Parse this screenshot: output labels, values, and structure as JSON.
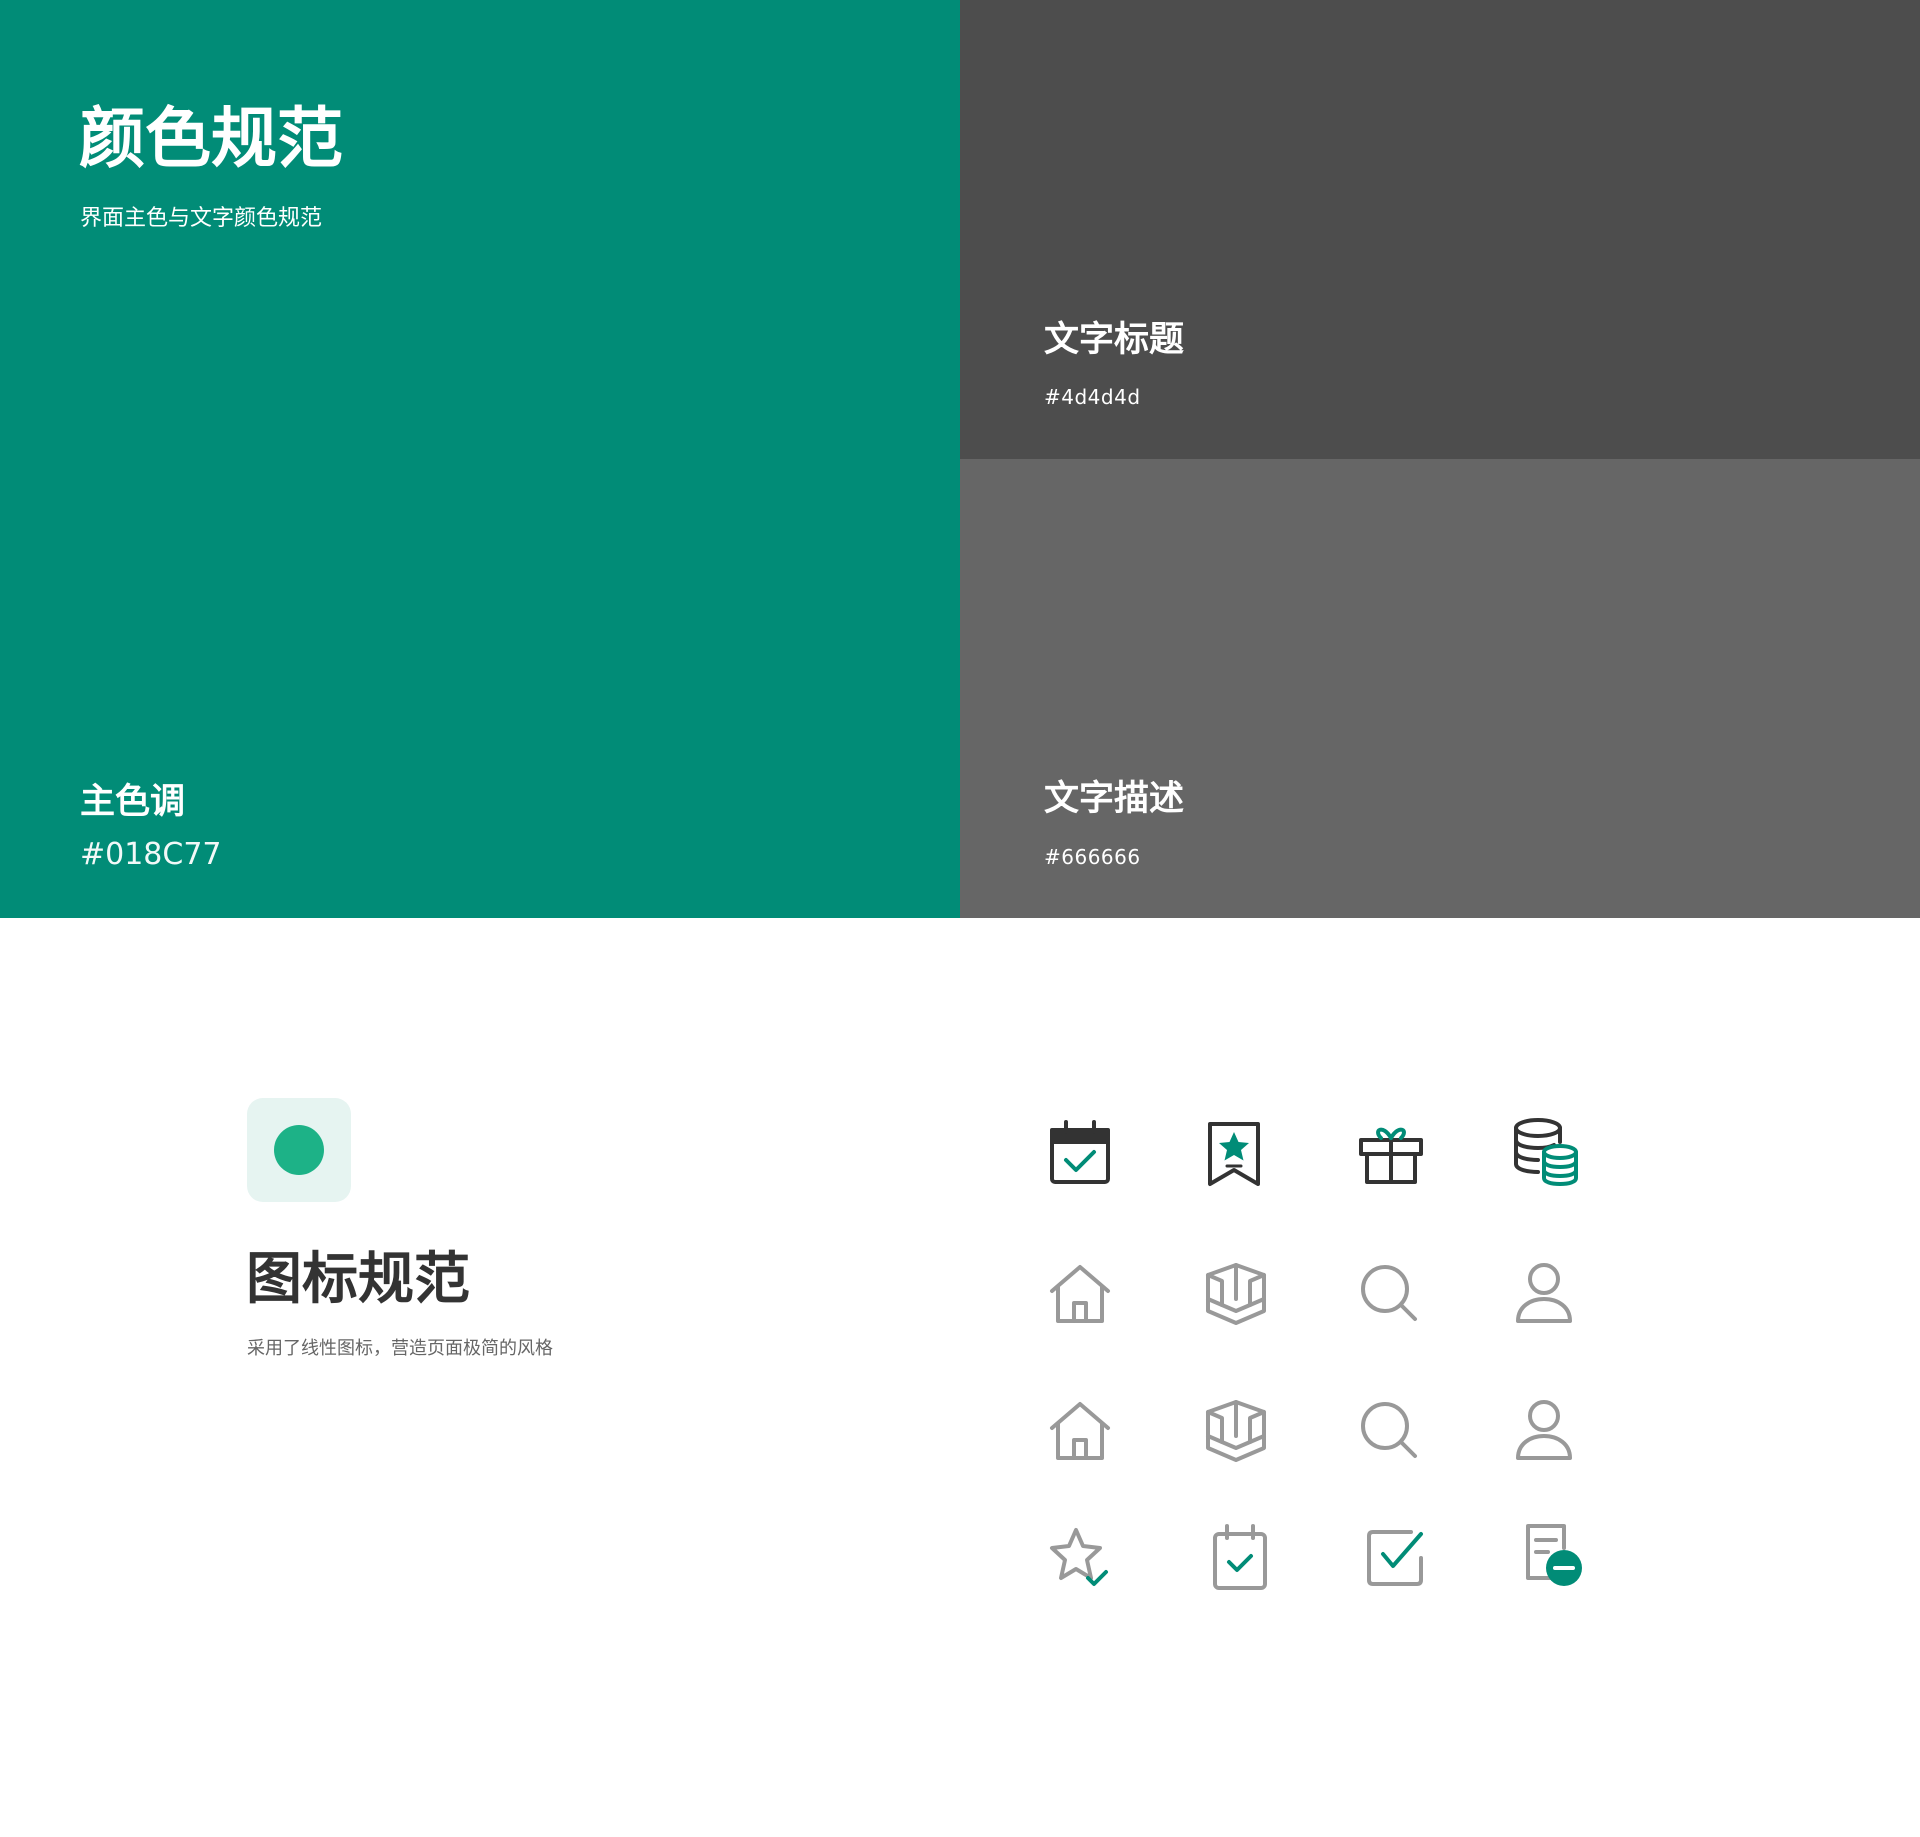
{
  "colors": {
    "title": "颜色规范",
    "subtitle": "界面主色与文字颜色规范",
    "primary": {
      "name": "主色调",
      "hex": "#018C77"
    },
    "text_title": {
      "name": "文字标题",
      "hex": "#4d4d4d"
    },
    "text_desc": {
      "name": "文字描述",
      "hex": "#666666"
    }
  },
  "icons_section": {
    "title": "图标规范",
    "description": "采用了线性图标，营造页面极简的风格"
  },
  "icon_grid": [
    [
      "calendar-check-icon",
      "bookmark-star-icon",
      "gift-icon",
      "coins-database-icon"
    ],
    [
      "home-icon",
      "cube-3d-icon",
      "search-icon",
      "user-icon"
    ],
    [
      "home-icon",
      "cube-3d-icon",
      "search-icon",
      "user-icon"
    ],
    [
      "star-check-icon",
      "calendar-check-outline-icon",
      "checkbox-icon",
      "document-minus-icon"
    ]
  ]
}
